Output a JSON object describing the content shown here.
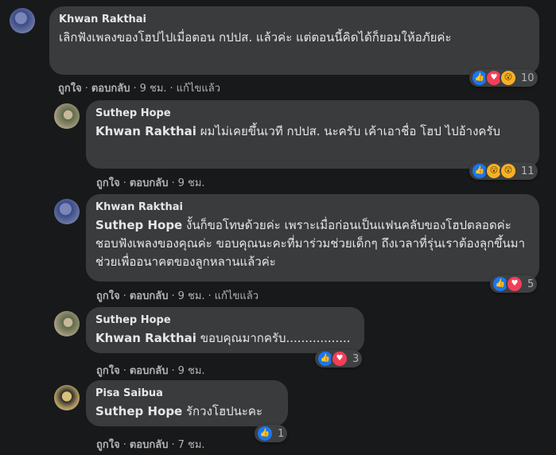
{
  "comments": [
    {
      "author": "Khwan Rakthai",
      "text": "เลิกฟังเพลงของโฮปไปเมื่อตอน กปปส. แล้วค่ะ แต่ตอนนี้คิดได้ก็ยอมให้อภัยค่ะ",
      "actions": {
        "like": "ถูกใจ",
        "reply": "ตอบกลับ",
        "time": "9 ชม.",
        "edited": "แก้ไขแล้ว"
      },
      "reactions": {
        "icons": [
          "like-icon",
          "love-icon",
          "wow-icon"
        ],
        "count": "10"
      }
    },
    {
      "author": "Suthep Hope",
      "tag": "Khwan Rakthai",
      "text": " ผมไม่เคยขึ้นเวที กปปส. นะครับ เค้าเอาชื่อ โฮป ไปอ้างครับ",
      "actions": {
        "like": "ถูกใจ",
        "reply": "ตอบกลับ",
        "time": "9 ชม."
      },
      "reactions": {
        "icons": [
          "like-icon",
          "wow-icon",
          "wow-icon"
        ],
        "count": "11"
      }
    },
    {
      "author": "Khwan Rakthai",
      "tag": "Suthep Hope",
      "text": " งั้นก็ขอโทษด้วยค่ะ เพราะเมื่อก่อนเป็นแฟนคลับของโฮปตลอดค่ะ ชอบฟังเพลงของคุณค่ะ ขอบคุณนะคะที่มาร่วมช่วยเด็กๆ ถึงเวลาที่รุ่นเราต้องลุกขึ้นมาช่วยเพื่ออนาคตของลูกหลานแล้วค่ะ",
      "actions": {
        "like": "ถูกใจ",
        "reply": "ตอบกลับ",
        "time": "9 ชม.",
        "edited": "แก้ไขแล้ว"
      },
      "reactions": {
        "icons": [
          "like-icon",
          "love-icon"
        ],
        "count": "5"
      }
    },
    {
      "author": "Suthep Hope",
      "tag": "Khwan Rakthai",
      "text": " ขอบคุณมากครับ.................",
      "actions": {
        "like": "ถูกใจ",
        "reply": "ตอบกลับ",
        "time": "9 ชม."
      },
      "reactions": {
        "icons": [
          "like-icon",
          "love-icon"
        ],
        "count": "3"
      }
    },
    {
      "author": "Pisa Saibua",
      "tag": "Suthep Hope",
      "text": " รักวงโฮปนะคะ",
      "actions": {
        "like": "ถูกใจ",
        "reply": "ตอบกลับ",
        "time": "7 ชม."
      },
      "reactions": {
        "icons": [
          "like-icon"
        ],
        "count": "1"
      }
    }
  ]
}
